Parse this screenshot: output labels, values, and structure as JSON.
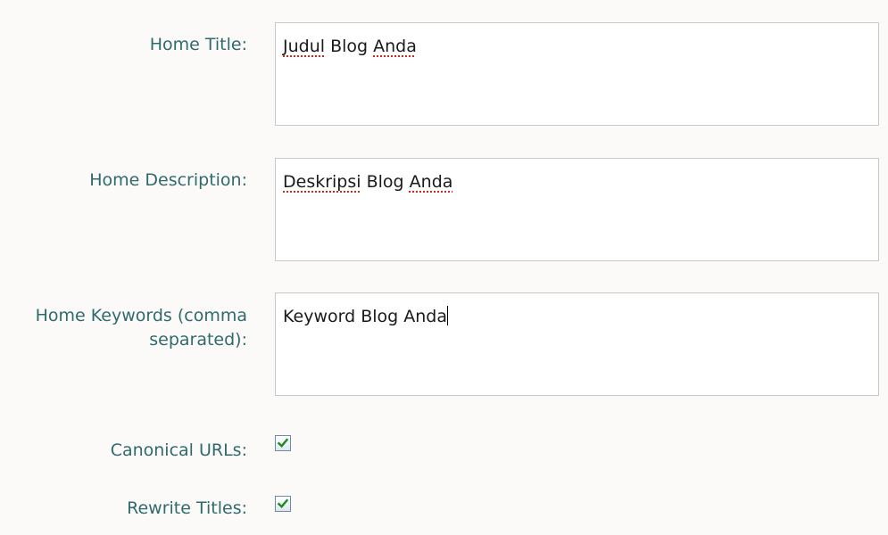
{
  "form": {
    "home_title": {
      "label": "Home Title:",
      "value_words": [
        "Judul",
        "Blog",
        "Anda"
      ]
    },
    "home_description": {
      "label": "Home Description:",
      "value_words": [
        "Deskripsi",
        "Blog",
        "Anda"
      ]
    },
    "home_keywords": {
      "label": "Home Keywords (comma\nseparated):",
      "value": "Keyword Blog Anda"
    },
    "canonical_urls": {
      "label": "Canonical URLs:",
      "checked": true
    },
    "rewrite_titles": {
      "label": "Rewrite Titles:",
      "checked": true
    }
  },
  "colors": {
    "label_text": "#2f6b6d",
    "spellcheck_underline": "#d0271d",
    "checkmark": "#1f8a1f"
  }
}
